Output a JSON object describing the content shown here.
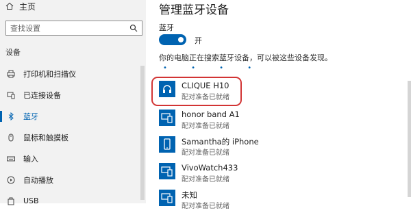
{
  "sidebar": {
    "home_label": "主页",
    "search_placeholder": "查找设置",
    "section_title": "设备",
    "items": [
      {
        "label": "打印机和扫描仪",
        "icon": "printer-icon"
      },
      {
        "label": "已连接设备",
        "icon": "connected-devices-icon"
      },
      {
        "label": "蓝牙",
        "icon": "bluetooth-icon",
        "active": true
      },
      {
        "label": "鼠标和触摸板",
        "icon": "mouse-icon"
      },
      {
        "label": "输入",
        "icon": "keyboard-icon"
      },
      {
        "label": "自动播放",
        "icon": "autoplay-icon"
      },
      {
        "label": "USB",
        "icon": "usb-icon"
      }
    ]
  },
  "main": {
    "title": "管理蓝牙设备",
    "bluetooth_label": "蓝牙",
    "toggle_state": "开",
    "info_text": "你的电脑正在搜索蓝牙设备，可以被这些设备发现。",
    "devices": [
      {
        "name": "CLIQUE H10",
        "status": "配对准备已就绪",
        "icon": "headset-icon"
      },
      {
        "name": "honor band A1",
        "status": "配对准备已就绪",
        "icon": "phone-pc-icon"
      },
      {
        "name": "Samantha的 iPhone",
        "status": "配对准备已就绪",
        "icon": "phone-icon"
      },
      {
        "name": "VivoWatch433",
        "status": "配对准备已就绪",
        "icon": "phone-pc-icon"
      },
      {
        "name": "未知",
        "status": "配对准备已就绪",
        "icon": "phone-pc-icon"
      }
    ]
  },
  "colors": {
    "accent": "#0063b1",
    "highlight": "#d23434"
  }
}
